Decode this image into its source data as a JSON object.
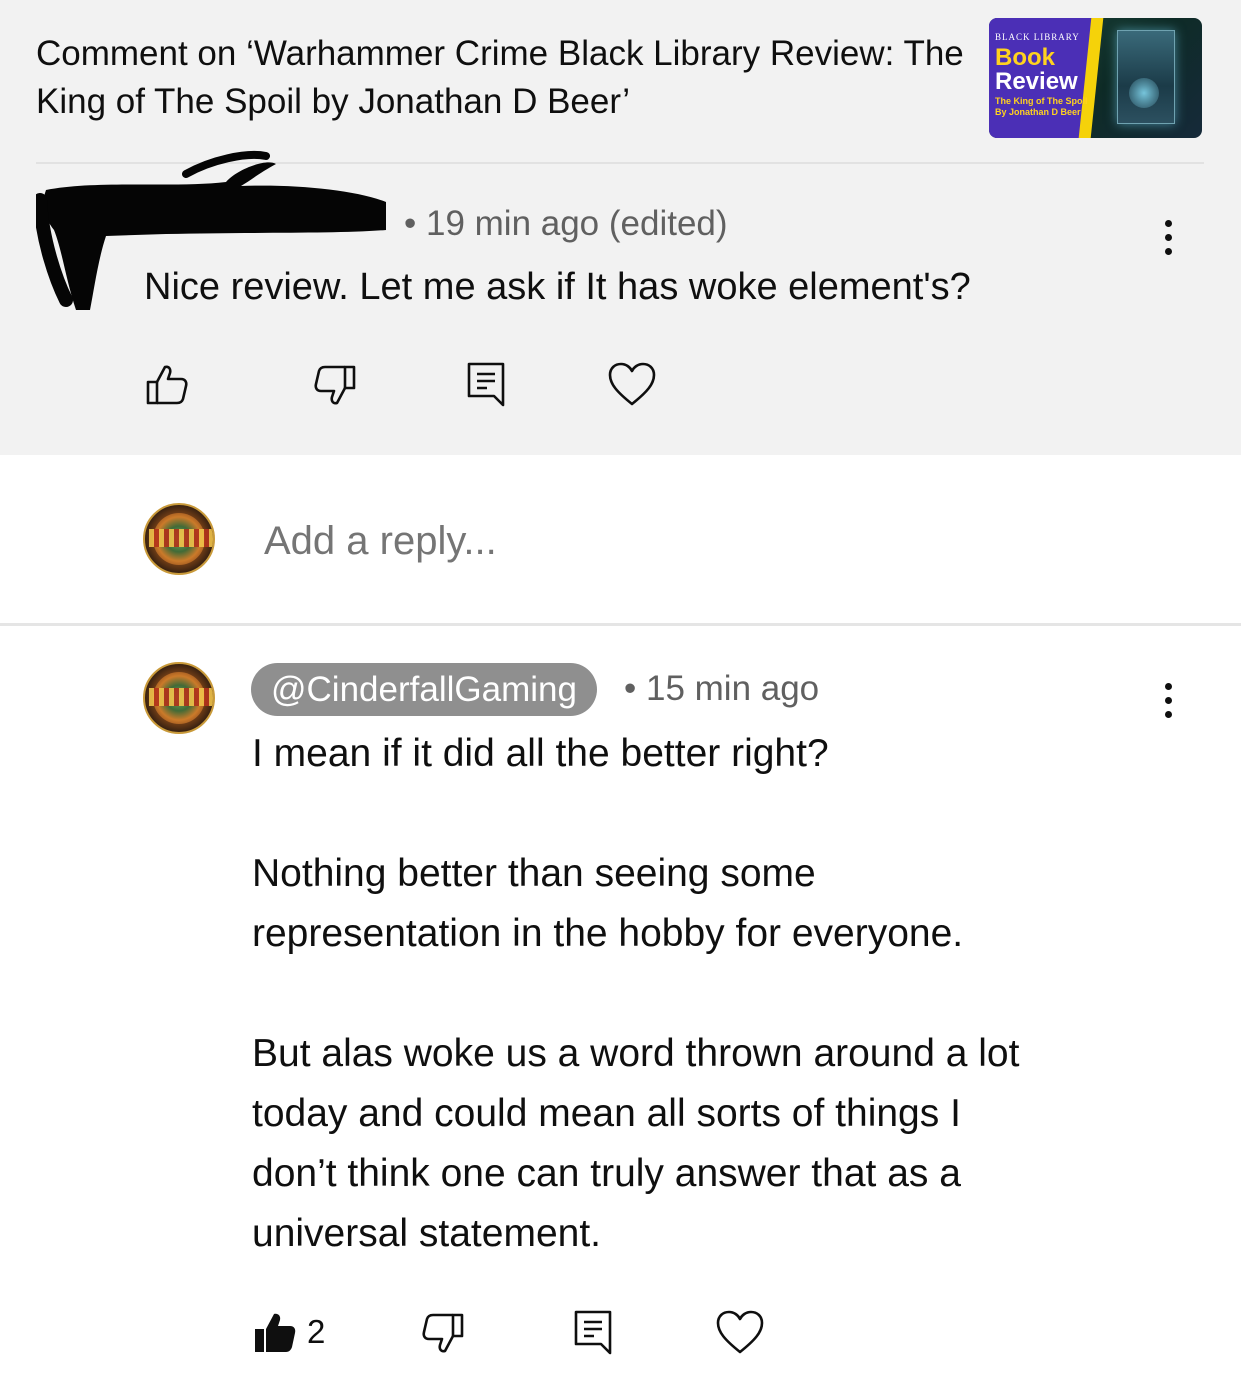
{
  "context": {
    "title": "Comment on ‘Warhammer Crime Black Library Review: The King of The Spoil by Jonathan D Beer’",
    "thumbnail": {
      "brand": "BLACK LIBRARY",
      "line1": "Book",
      "line2": "Review",
      "line3": "The King of The Spoil",
      "line4": "By Jonathan D Beer"
    }
  },
  "parent_comment": {
    "author_redacted": true,
    "meta": "• 19 min ago (edited)",
    "text": "Nice review. Let me ask if It has woke element's?",
    "actions": {
      "like_icon": "thumbs-up-outline-icon",
      "dislike_icon": "thumbs-down-outline-icon",
      "reply_icon": "reply-comment-icon",
      "heart_icon": "heart-outline-icon"
    }
  },
  "reply_box": {
    "placeholder": "Add a reply..."
  },
  "reply_comment": {
    "author": "@CinderfallGaming",
    "meta": "• 15 min ago",
    "paragraphs": [
      "I mean if it did all the better right?",
      "Nothing better than seeing some\nrepresentation in the hobby for everyone.",
      "But alas woke us a word thrown around a lot\ntoday and could mean all sorts of things I\ndon’t think one can truly answer that as a\nuniversal statement."
    ],
    "like_count": "2",
    "actions": {
      "like_icon": "thumbs-up-filled-icon",
      "dislike_icon": "thumbs-down-outline-icon",
      "reply_icon": "reply-comment-icon",
      "heart_icon": "heart-outline-icon"
    }
  },
  "colors": {
    "panel_bg": "#f2f2f2",
    "chip_bg": "#8f8f8f",
    "secondary_text": "#606060"
  }
}
